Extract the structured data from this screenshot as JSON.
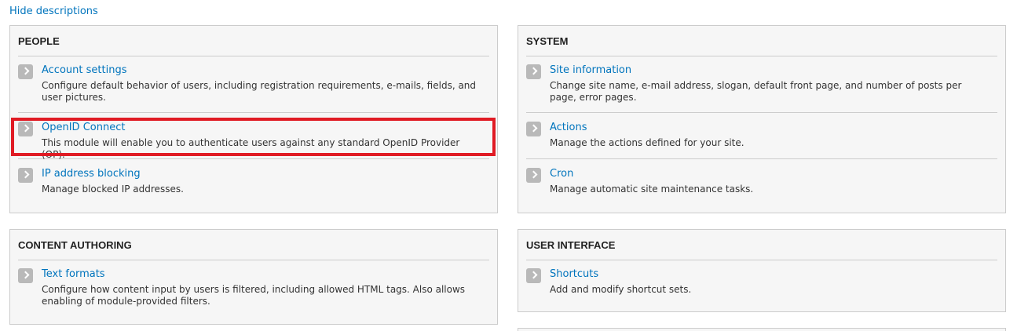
{
  "toggle_label": "Hide descriptions",
  "colors": {
    "link": "#0074bd",
    "highlight": "#e01b24",
    "panel_bg": "#f6f6f6"
  },
  "panels": {
    "people": {
      "title": "PEOPLE",
      "items": [
        {
          "title": "Account settings",
          "description": "Configure default behavior of users, including registration requirements, e-mails, fields, and user pictures."
        },
        {
          "title": "OpenID Connect",
          "description": "This module will enable you to authenticate users against any standard OpenID Provider (OP)."
        },
        {
          "title": "IP address blocking",
          "description": "Manage blocked IP addresses."
        }
      ]
    },
    "system": {
      "title": "SYSTEM",
      "items": [
        {
          "title": "Site information",
          "description": "Change site name, e-mail address, slogan, default front page, and number of posts per page, error pages."
        },
        {
          "title": "Actions",
          "description": "Manage the actions defined for your site."
        },
        {
          "title": "Cron",
          "description": "Manage automatic site maintenance tasks."
        }
      ]
    },
    "content_authoring": {
      "title": "CONTENT AUTHORING",
      "items": [
        {
          "title": "Text formats",
          "description": "Configure how content input by users is filtered, including allowed HTML tags. Also allows enabling of module-provided filters."
        }
      ]
    },
    "user_interface": {
      "title": "USER INTERFACE",
      "items": [
        {
          "title": "Shortcuts",
          "description": "Add and modify shortcut sets."
        }
      ]
    }
  }
}
